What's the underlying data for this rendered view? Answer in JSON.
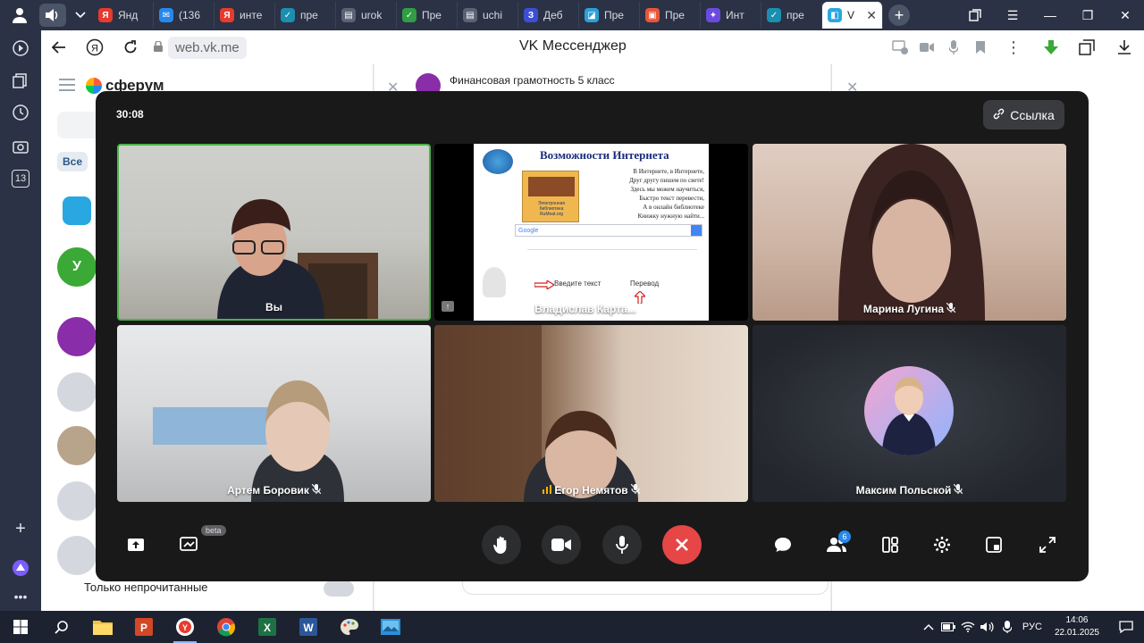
{
  "browser": {
    "tabs": [
      {
        "label": "Янд",
        "fav_color": "#e63b2e",
        "fav_glyph": "Я"
      },
      {
        "label": "(136",
        "fav_color": "#2688eb",
        "fav_glyph": "✉"
      },
      {
        "label": "инте",
        "fav_color": "#e63b2e",
        "fav_glyph": "Я"
      },
      {
        "label": "пре",
        "fav_color": "#1a8fb0",
        "fav_glyph": "✓"
      },
      {
        "label": "urok",
        "fav_color": "#5a6275",
        "fav_glyph": "▤"
      },
      {
        "label": "Пре",
        "fav_color": "#2f9e44",
        "fav_glyph": "✓"
      },
      {
        "label": "uchi",
        "fav_color": "#5a6275",
        "fav_glyph": "▤"
      },
      {
        "label": "Деб",
        "fav_color": "#3b4fd6",
        "fav_glyph": "З"
      },
      {
        "label": "Пре",
        "fav_color": "#2aa0d8",
        "fav_glyph": "◪"
      },
      {
        "label": "Пре",
        "fav_color": "#e8553a",
        "fav_glyph": "▣"
      },
      {
        "label": "Инт",
        "fav_color": "#6b4ae0",
        "fav_glyph": "✦"
      },
      {
        "label": "пре",
        "fav_color": "#1a8fb0",
        "fav_glyph": "✓"
      }
    ],
    "active_tab": {
      "label": "V",
      "fav_color": "#29a7e1"
    },
    "address_domain": "web.vk.me",
    "page_title": "VK Мессенджер",
    "sidebar_badge": "13"
  },
  "vk": {
    "logo": "сферум",
    "chat_title": "Финансовая грамотность 5 класс",
    "filter_all": "Все",
    "unread_only": "Только непрочитанные"
  },
  "call": {
    "timer": "30:08",
    "link_label": "Ссылка",
    "participants": [
      {
        "name": "Вы",
        "muted": false,
        "speaking": false
      },
      {
        "name": "Владислав Карта...",
        "muted": true,
        "speaking": false
      },
      {
        "name": "Марина Лугина",
        "muted": true,
        "speaking": false
      },
      {
        "name": "Артем Боровик",
        "muted": true,
        "speaking": false
      },
      {
        "name": "Егор Немятов",
        "muted": true,
        "speaking": true
      },
      {
        "name": "Максим Польской",
        "muted": true,
        "speaking": false
      }
    ],
    "slide": {
      "title": "Возможности Интернета",
      "poem": [
        "В Интернете, в Интернете,",
        "Друг другу пишем по свете!",
        "Здесь мы можем научиться,",
        "Быстро текст перевести,",
        "А в онлайн библиотеке",
        "Книжку нужную найти..."
      ],
      "book_caption": [
        "Электронная",
        "библиотека",
        "RuMeat.org"
      ],
      "search_brand": "Google",
      "input_text": "Введите текст",
      "translate_text": "Перевод"
    },
    "beta_label": "beta",
    "participants_count": "6"
  },
  "taskbar": {
    "lang": "РУС",
    "time": "14:06",
    "date": "22.01.2025"
  }
}
